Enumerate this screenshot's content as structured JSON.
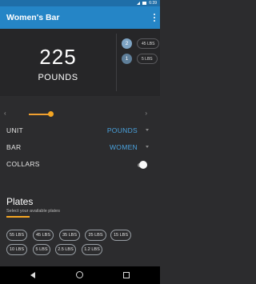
{
  "status_bar": {
    "time": "6:39"
  },
  "app_bar": {
    "title": "Women's Bar"
  },
  "summary": {
    "weight": "225",
    "unit": "POUNDS",
    "plate_counts": [
      {
        "count": "2",
        "plate": "45 LBS"
      },
      {
        "count": "1",
        "plate": "5 LBS"
      }
    ]
  },
  "controls": {
    "slider_value": 0.1,
    "unit": {
      "label": "UNIT",
      "value": "POUNDS"
    },
    "bar": {
      "label": "BAR",
      "value": "WOMEN"
    },
    "collars": {
      "label": "COLLARS",
      "enabled": false
    }
  },
  "plates": {
    "title": "Plates",
    "subtitle": "Select your available plates",
    "items": [
      "55 LBS",
      "45 LBS",
      "35 LBS",
      "25 LBS",
      "15 LBS",
      "10 LBS",
      "5 LBS",
      "2.5 LBS",
      "1.2 LBS"
    ]
  },
  "colors": {
    "app_bar": "#2585c6",
    "accent": "#f5a623",
    "value_text": "#4aa3df",
    "background": "#2c2c2e"
  }
}
